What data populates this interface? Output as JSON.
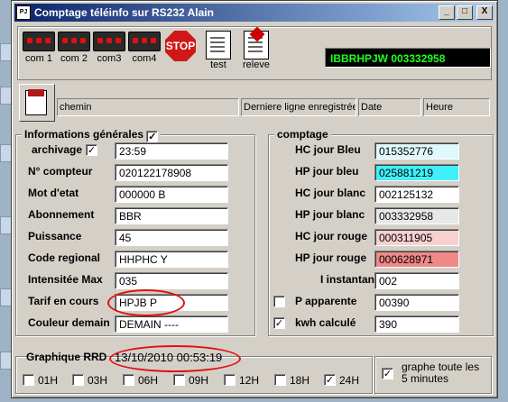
{
  "window": {
    "title": "Comptage téléinfo sur RS232 Alain",
    "app_icon": "PJ"
  },
  "title_buttons": {
    "minimize": "_",
    "maximize": "□",
    "close": "X"
  },
  "toolbar": {
    "com1": "com 1",
    "com2": "com 2",
    "com3": "com3",
    "com4": "com4",
    "stop": "STOP",
    "test": "test",
    "releve": "releve"
  },
  "display": "IBBRHPJW 003332958",
  "pathbar": {
    "chemin": "chemin",
    "derniere": "Derniere ligne enregistrée a:",
    "date": "Date",
    "heure": "Heure"
  },
  "general": {
    "title": "Informations générales",
    "title_checked": "✓",
    "archivage_label": "archivage",
    "archivage_checked": "✓",
    "archivage_value": "23:59",
    "rows": [
      {
        "label": "N° compteur",
        "value": "020122178908"
      },
      {
        "label": "Mot d'etat",
        "value": "000000 B"
      },
      {
        "label": "Abonnement",
        "value": "BBR"
      },
      {
        "label": "Puissance",
        "value": "45"
      },
      {
        "label": "Code regional",
        "value": "HHPHC Y"
      },
      {
        "label": "Intensitée Max",
        "value": "035"
      },
      {
        "label": "Tarif en cours",
        "value": "HPJB P"
      },
      {
        "label": "Couleur demain",
        "value": "DEMAIN ----"
      }
    ]
  },
  "comptage": {
    "title": "comptage",
    "rows": [
      {
        "label": "HC jour Bleu",
        "value": "015352776",
        "color": "#dff8fb"
      },
      {
        "label": "HP jour bleu",
        "value": "025881219",
        "color": "#40f0f8"
      },
      {
        "label": "HC jour blanc",
        "value": "002125132",
        "color": "#ffffff"
      },
      {
        "label": "HP jour blanc",
        "value": "003332958",
        "color": "#e8e8e8"
      },
      {
        "label": "HC jour rouge",
        "value": "000311905",
        "color": "#f8d0d0"
      },
      {
        "label": "HP jour rouge",
        "value": "000628971",
        "color": "#f08888"
      },
      {
        "label": "I instantanné",
        "value": "002",
        "color": "#ffffff"
      },
      {
        "label": "P apparente",
        "value": "00390",
        "color": "#ffffff",
        "checkbox": ""
      },
      {
        "label": "kwh calculé",
        "value": "390",
        "color": "#ffffff",
        "checkbox": "✓"
      }
    ]
  },
  "graph": {
    "title": "Graphique RRD",
    "timestamp": "13/10/2010 00:53:19",
    "options": [
      {
        "label": "01H",
        "checked": ""
      },
      {
        "label": "03H",
        "checked": ""
      },
      {
        "label": "06H",
        "checked": ""
      },
      {
        "label": "09H",
        "checked": ""
      },
      {
        "label": "12H",
        "checked": ""
      },
      {
        "label": "18H",
        "checked": ""
      },
      {
        "label": "24H",
        "checked": "✓"
      }
    ],
    "toute_label": "graphe toute les 5 minutes",
    "toute_checked": "✓"
  }
}
